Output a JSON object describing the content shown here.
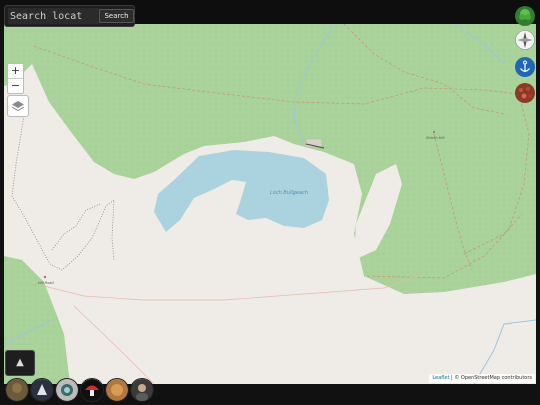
{
  "search": {
    "placeholder": "Search locat",
    "button_label": "Search"
  },
  "zoom": {
    "in_label": "+",
    "out_label": "−"
  },
  "map": {
    "water_label": "Loch Bullgeach",
    "place_labels": [
      "Hill Road",
      "Shielin Hill"
    ],
    "colors": {
      "forest": "#a9d39a",
      "water": "#aad3df",
      "land": "#efebe6",
      "path": "#c79a78",
      "stream": "#9dc6e0"
    }
  },
  "panel_toggle_label": "▲",
  "corner_buttons": [
    {
      "name": "tree-icon"
    },
    {
      "name": "compass-icon"
    },
    {
      "name": "anchor-icon"
    },
    {
      "name": "terrain-icon"
    }
  ],
  "avatars": [
    {
      "name": "avatar-1"
    },
    {
      "name": "avatar-2"
    },
    {
      "name": "avatar-3"
    },
    {
      "name": "avatar-4"
    },
    {
      "name": "avatar-5"
    },
    {
      "name": "avatar-6"
    }
  ],
  "attribution": {
    "leaflet": "Leaflet",
    "rest": " | © OpenStreetMap contributors"
  }
}
